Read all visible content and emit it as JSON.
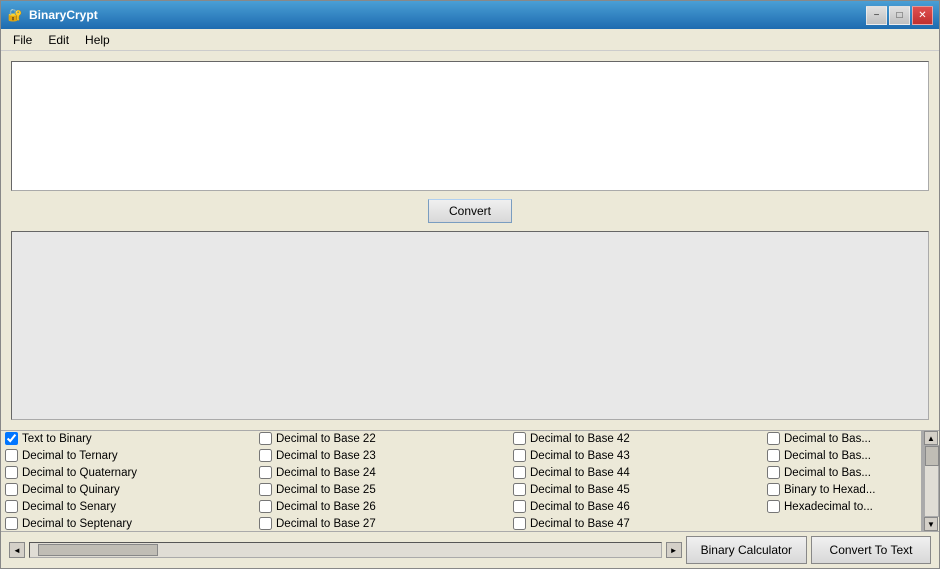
{
  "window": {
    "title": "BinaryCrypt",
    "icon": "🔐"
  },
  "titlebar": {
    "minimize": "−",
    "maximize": "□",
    "close": "✕"
  },
  "menu": {
    "items": [
      "File",
      "Edit",
      "Help"
    ]
  },
  "input_area": {
    "placeholder": ""
  },
  "convert_button": {
    "label": "Convert"
  },
  "bottom_buttons": {
    "binary_calc": "Binary Calculator",
    "convert_text": "Convert To Text"
  },
  "checkboxes": {
    "col1": [
      {
        "label": "Text to Binary",
        "checked": true
      },
      {
        "label": "Decimal to Ternary",
        "checked": false
      },
      {
        "label": "Decimal to Quaternary",
        "checked": false
      },
      {
        "label": "Decimal to Quinary",
        "checked": false
      },
      {
        "label": "Decimal to Senary",
        "checked": false
      },
      {
        "label": "Decimal to Septenary",
        "checked": false
      }
    ],
    "col2": [
      {
        "label": "Decimal to Base 22",
        "checked": false
      },
      {
        "label": "Decimal to Base 23",
        "checked": false
      },
      {
        "label": "Decimal to Base 24",
        "checked": false
      },
      {
        "label": "Decimal to Base 25",
        "checked": false
      },
      {
        "label": "Decimal to Base 26",
        "checked": false
      },
      {
        "label": "Decimal to Base 27",
        "checked": false
      }
    ],
    "col3": [
      {
        "label": "Decimal to Base 42",
        "checked": false
      },
      {
        "label": "Decimal to Base 43",
        "checked": false
      },
      {
        "label": "Decimal to Base 44",
        "checked": false
      },
      {
        "label": "Decimal to Base 45",
        "checked": false
      },
      {
        "label": "Decimal to Base 46",
        "checked": false
      },
      {
        "label": "Decimal to Base 47",
        "checked": false
      }
    ],
    "col4": [
      {
        "label": "Decimal to Bas...",
        "checked": false
      },
      {
        "label": "Decimal to Bas...",
        "checked": false
      },
      {
        "label": "Decimal to Bas...",
        "checked": false
      },
      {
        "label": "Binary to Hexad...",
        "checked": false
      },
      {
        "label": "Hexadecimal to...",
        "checked": false
      }
    ]
  }
}
